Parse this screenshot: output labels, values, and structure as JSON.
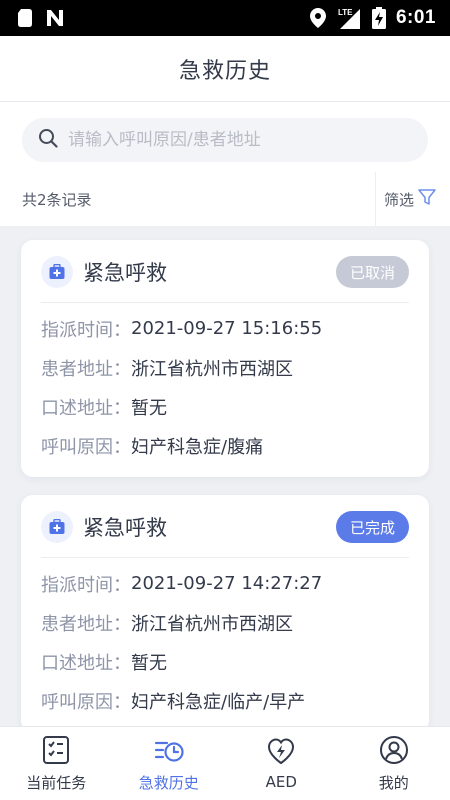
{
  "status_bar": {
    "time": "6:01",
    "network": "LTE",
    "icons": [
      "sim-card-icon",
      "n-icon",
      "location-icon",
      "signal-icon",
      "battery-charging-icon"
    ]
  },
  "header": {
    "title": "急救历史"
  },
  "search": {
    "placeholder": "请输入呼叫原因/患者地址",
    "value": ""
  },
  "summary": {
    "count_text": "共2条记录",
    "filter_label": "筛选"
  },
  "labels": {
    "dispatch_time": "指派时间：",
    "patient_address": "患者地址：",
    "oral_address": "口述地址：",
    "call_reason": "呼叫原因："
  },
  "records": [
    {
      "title": "紧急呼救",
      "status": "已取消",
      "dispatch_time": "2021-09-27 15:16:55",
      "patient_address": "浙江省杭州市西湖区",
      "oral_address": "暂无",
      "call_reason": "妇产科急症/腹痛"
    },
    {
      "title": "紧急呼救",
      "status": "已完成",
      "dispatch_time": "2021-09-27 14:27:27",
      "patient_address": "浙江省杭州市西湖区",
      "oral_address": "暂无",
      "call_reason": "妇产科急症/临产/早产"
    }
  ],
  "tabs": [
    {
      "label": "当前任务",
      "icon": "task-list-icon",
      "active": false
    },
    {
      "label": "急救历史",
      "icon": "history-icon",
      "active": true
    },
    {
      "label": "AED",
      "icon": "aed-heart-icon",
      "active": false
    },
    {
      "label": "我的",
      "icon": "user-icon",
      "active": false
    }
  ],
  "colors": {
    "accent": "#4f73e6",
    "badge_cancelled": "#c6cad6",
    "badge_completed": "#5b7be8",
    "label_gray": "#8e95a8",
    "text_dark": "#333a4a"
  }
}
